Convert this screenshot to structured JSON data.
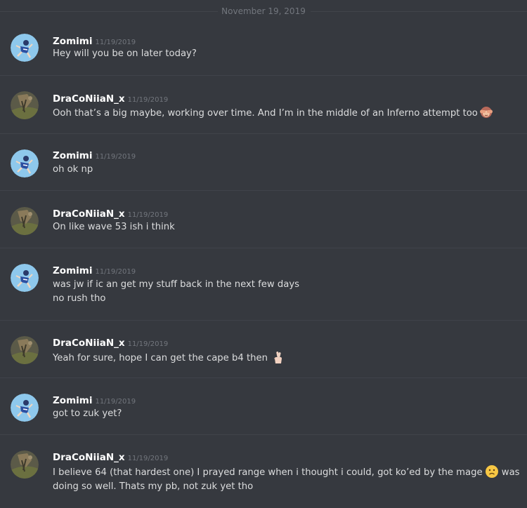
{
  "date_divider": "November 19, 2019",
  "messages": [
    {
      "user": "Zomimi",
      "time": "11/19/2019",
      "lines": [
        "Hey will you be on later today?"
      ]
    },
    {
      "user": "DraCoNiiaN_x",
      "time": "11/19/2019",
      "lines": [
        "Ooh that’s a big maybe, working over time. And I’m in the middle of an Inferno attempt too"
      ],
      "emoji": "see-no-evil-monkey"
    },
    {
      "user": "Zomimi",
      "time": "11/19/2019",
      "lines": [
        "oh ok np"
      ]
    },
    {
      "user": "DraCoNiiaN_x",
      "time": "11/19/2019",
      "lines": [
        "On like wave 53 ish i think"
      ]
    },
    {
      "user": "Zomimi",
      "time": "11/19/2019",
      "lines": [
        "was jw if ic an get my stuff back in the next few days",
        "no rush tho"
      ]
    },
    {
      "user": "DraCoNiiaN_x",
      "time": "11/19/2019",
      "lines": [
        "Yeah for sure, hope I can get the cape b4 then"
      ],
      "emoji": "crossed-fingers"
    },
    {
      "user": "Zomimi",
      "time": "11/19/2019",
      "lines": [
        "got to zuk yet?"
      ]
    },
    {
      "user": "DraCoNiiaN_x",
      "time": "11/19/2019",
      "lines": [
        "I believe 64 (that hardest one) I prayed range when i thought i could, got ko’ed by the mage",
        "doing so well. Thats my pb, not zuk yet tho"
      ],
      "inline_emoji_after": "slightly-frowning-face",
      "inline_text_after": "was"
    }
  ],
  "colors": {
    "background": "#36393f",
    "username": "#ffffff",
    "text": "#dcddde",
    "timestamp": "#72767d"
  }
}
